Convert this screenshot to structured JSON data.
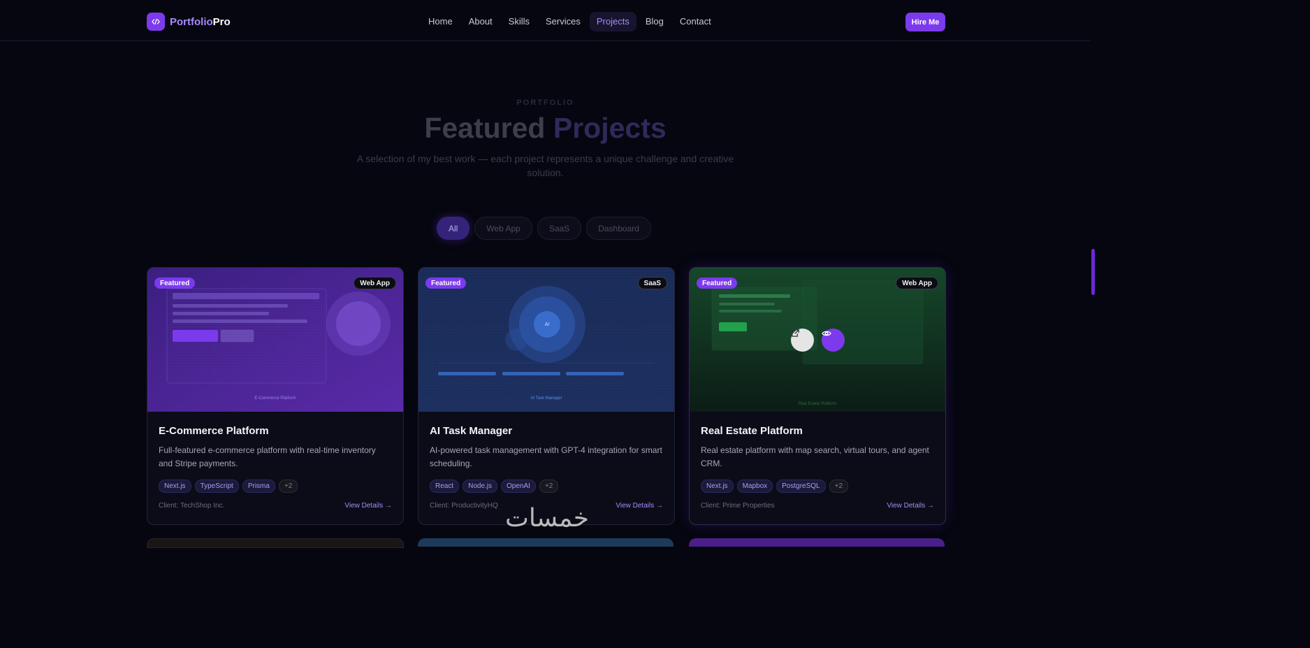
{
  "brand": {
    "name_a": "Portfolio",
    "name_b": "Pro",
    "logo_icon": "code-icon"
  },
  "nav": {
    "links": [
      "Home",
      "About",
      "Skills",
      "Services",
      "Projects",
      "Blog",
      "Contact"
    ],
    "active": "Projects",
    "cta": "Hire Me"
  },
  "header": {
    "eyebrow": "PORTFOLIO",
    "title_a": "Featured",
    "title_b": "Projects",
    "subtitle": "A selection of my best work — each project represents a unique challenge and creative solution."
  },
  "filters": {
    "items": [
      "All",
      "Web App",
      "SaaS",
      "Dashboard"
    ],
    "active": "All"
  },
  "projects": [
    {
      "featured": "Featured",
      "category": "Web App",
      "thumb_caption": "E-Commerce Platform",
      "title": "E-Commerce Platform",
      "description": "Full-featured e-commerce platform with real-time inventory and Stripe payments.",
      "tags": [
        "Next.js",
        "TypeScript",
        "Prisma"
      ],
      "more": "+2",
      "client": "Client: TechShop Inc.",
      "cta": "View Details →",
      "accent": "#7c3aed"
    },
    {
      "featured": "Featured",
      "category": "SaaS",
      "thumb_caption": "AI Task Manager",
      "thumb_center": "AI",
      "title": "AI Task Manager",
      "description": "AI-powered task management with GPT-4 integration for smart scheduling.",
      "tags": [
        "React",
        "Node.js",
        "OpenAI"
      ],
      "more": "+2",
      "client": "Client: ProductivityHQ",
      "cta": "View Details →",
      "accent": "#2563eb"
    },
    {
      "featured": "Featured",
      "category": "Web App",
      "thumb_caption": "Real Estate Platform",
      "title": "Real Estate Platform",
      "description": "Real estate platform with map search, virtual tours, and agent CRM.",
      "tags": [
        "Next.js",
        "Mapbox",
        "PostgreSQL"
      ],
      "more": "+2",
      "client": "Client: Prime Properties",
      "cta": "View Details →",
      "accent": "#16a34a",
      "overlay_icons": [
        "external-link-icon",
        "eye-icon"
      ]
    }
  ],
  "colors": {
    "background": "#05060f",
    "accent": "#7c3aed",
    "accent_light": "#a78bfa"
  },
  "watermark": "خمسات"
}
